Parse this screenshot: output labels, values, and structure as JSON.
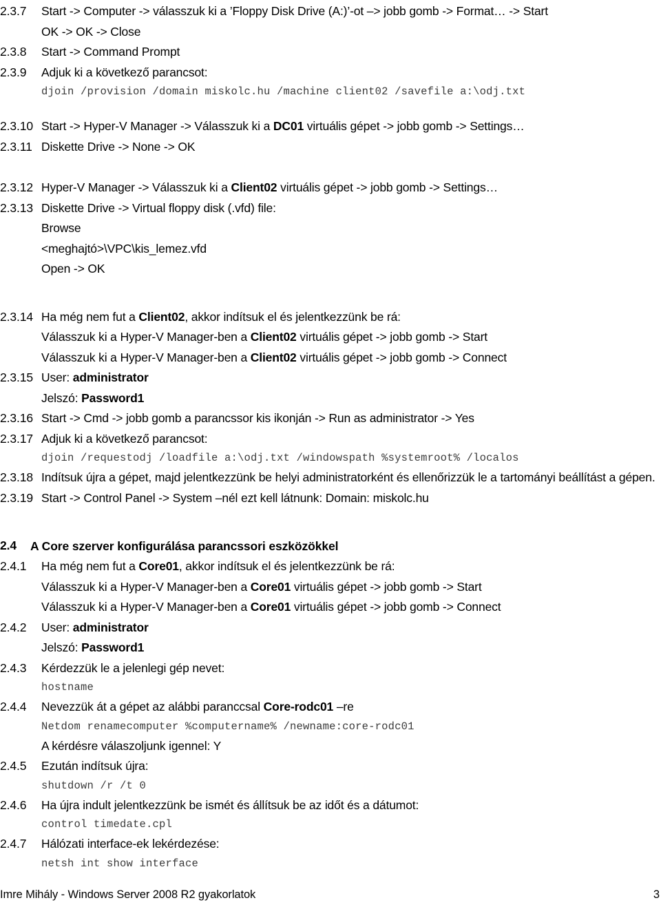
{
  "document": {
    "language": "hu",
    "page_number": "3",
    "footer_left": "Imre Mihály - Windows Server 2008 R2 gyakorlatok"
  },
  "entries": {
    "e237": {
      "num": "2.3.7",
      "line1": "Start -> Computer -> válasszuk ki a ’Floppy Disk Drive (A:)’-ot –> jobb gomb -> Format… -> Start",
      "line2": "OK -> OK -> Close"
    },
    "e238": {
      "num": "2.3.8",
      "line1": "Start -> Command Prompt"
    },
    "e239": {
      "num": "2.3.9",
      "line1": "Adjuk ki a következő parancsot:",
      "command": "djoin /provision /domain miskolc.hu /machine client02 /savefile a:\\odj.txt"
    },
    "e2310": {
      "num": "2.3.10",
      "pre": "Start -> Hyper-V Manager -> Válasszuk ki a ",
      "bold": "DC01",
      "post": " virtuális gépet -> jobb gomb -> Settings…"
    },
    "e2311": {
      "num": "2.3.11",
      "line1": "Diskette Drive -> None -> OK"
    },
    "e2312": {
      "num": "2.3.12",
      "pre": "Hyper-V Manager -> Válasszuk ki a ",
      "bold": "Client02",
      "post": " virtuális gépet -> jobb gomb -> Settings…"
    },
    "e2313": {
      "num": "2.3.13",
      "line1": "Diskette Drive -> Virtual floppy disk (.vfd) file:",
      "line2": "Browse",
      "line3": "<meghajtó>\\VPC\\kis_lemez.vfd",
      "line4": "Open -> OK"
    },
    "e2314": {
      "num": "2.3.14",
      "pre": "Ha még nem fut a ",
      "bold": "Client02",
      "post": ", akkor indítsuk el és jelentkezzünk be rá:",
      "sub1_pre": "Válasszuk ki a Hyper-V Manager-ben a ",
      "sub1_bold": "Client02",
      "sub1_post": " virtuális gépet -> jobb gomb -> Start",
      "sub2_pre": "Válasszuk ki a Hyper-V Manager-ben a ",
      "sub2_bold": "Client02",
      "sub2_post": " virtuális gépet -> jobb gomb -> Connect"
    },
    "e2315": {
      "num": "2.3.15",
      "user_label": "User: ",
      "user_value": "administrator",
      "pass_label": "Jelszó: ",
      "pass_value": "Password1"
    },
    "e2316": {
      "num": "2.3.16",
      "line1": "Start -> Cmd -> jobb gomb a parancssor kis ikonján -> Run as administrator -> Yes"
    },
    "e2317": {
      "num": "2.3.17",
      "line1": "Adjuk ki a következő parancsot:",
      "command": "djoin /requestodj /loadfile a:\\odj.txt /windowspath %systemroot% /localos"
    },
    "e2318": {
      "num": "2.3.18",
      "line1": "Indítsuk újra a gépet, majd jelentkezzünk be helyi administratorként és ellenőrizzük le a tartományi beállítást a gépen."
    },
    "e2319": {
      "num": "2.3.19",
      "line1": "Start -> Control Panel -> System –nél ezt kell látnunk: Domain: miskolc.hu"
    },
    "s24": {
      "num": "2.4",
      "title": "A Core szerver konfigurálása parancssori eszközökkel"
    },
    "e241": {
      "num": "2.4.1",
      "pre": "Ha még nem fut a ",
      "bold": "Core01",
      "post": ", akkor indítsuk el és jelentkezzünk be rá:",
      "sub1_pre": "Válasszuk ki a Hyper-V Manager-ben a ",
      "sub1_bold": "Core01",
      "sub1_post": " virtuális gépet -> jobb gomb -> Start",
      "sub2_pre": "Válasszuk ki a Hyper-V Manager-ben a ",
      "sub2_bold": "Core01",
      "sub2_post": " virtuális gépet -> jobb gomb -> Connect"
    },
    "e242": {
      "num": "2.4.2",
      "user_label": "User: ",
      "user_value": "administrator",
      "pass_label": "Jelszó: ",
      "pass_value": "Password1"
    },
    "e243": {
      "num": "2.4.3",
      "line1": "Kérdezzük le a jelenlegi gép nevet:",
      "command": "hostname"
    },
    "e244": {
      "num": "2.4.4",
      "pre": "Nevezzük át a gépet az alábbi paranccsal ",
      "bold": "Core-rodc01",
      "post": " –re",
      "command": "Netdom renamecomputer %computername% /newname:core-rodc01",
      "after": "A kérdésre válaszoljunk igennel: Y"
    },
    "e245": {
      "num": "2.4.5",
      "line1": "Ezután indítsuk újra:",
      "command": "shutdown /r /t 0"
    },
    "e246": {
      "num": "2.4.6",
      "line1": "Ha újra indult jelentkezzünk be ismét és állítsuk be az időt és a dátumot:",
      "command": "control timedate.cpl"
    },
    "e247": {
      "num": "2.4.7",
      "line1": "Hálózati interface-ek lekérdezése:",
      "command": "netsh int show interface"
    }
  }
}
